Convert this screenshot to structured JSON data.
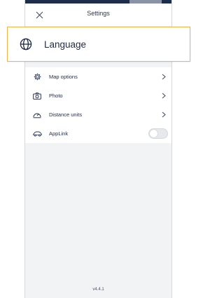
{
  "header": {
    "title": "Settings",
    "close_icon": "close-icon"
  },
  "focused_item": {
    "label": "Language",
    "icon": "globe-icon",
    "highlight_color": "#e8b64b"
  },
  "settings": {
    "items": [
      {
        "label": "Map options",
        "icon": "gear-icon",
        "control": "chevron"
      },
      {
        "label": "Photo",
        "icon": "camera-icon",
        "control": "chevron"
      },
      {
        "label": "Distance units",
        "icon": "odometer-icon",
        "control": "chevron"
      },
      {
        "label": "AppLink",
        "icon": "car-icon",
        "control": "toggle",
        "toggle_on": false
      }
    ]
  },
  "footer": {
    "version": "v4.4.1"
  },
  "colors": {
    "status_bar": "#1d2d4a",
    "text": "#1f2a44",
    "background": "#f2f3f5"
  }
}
